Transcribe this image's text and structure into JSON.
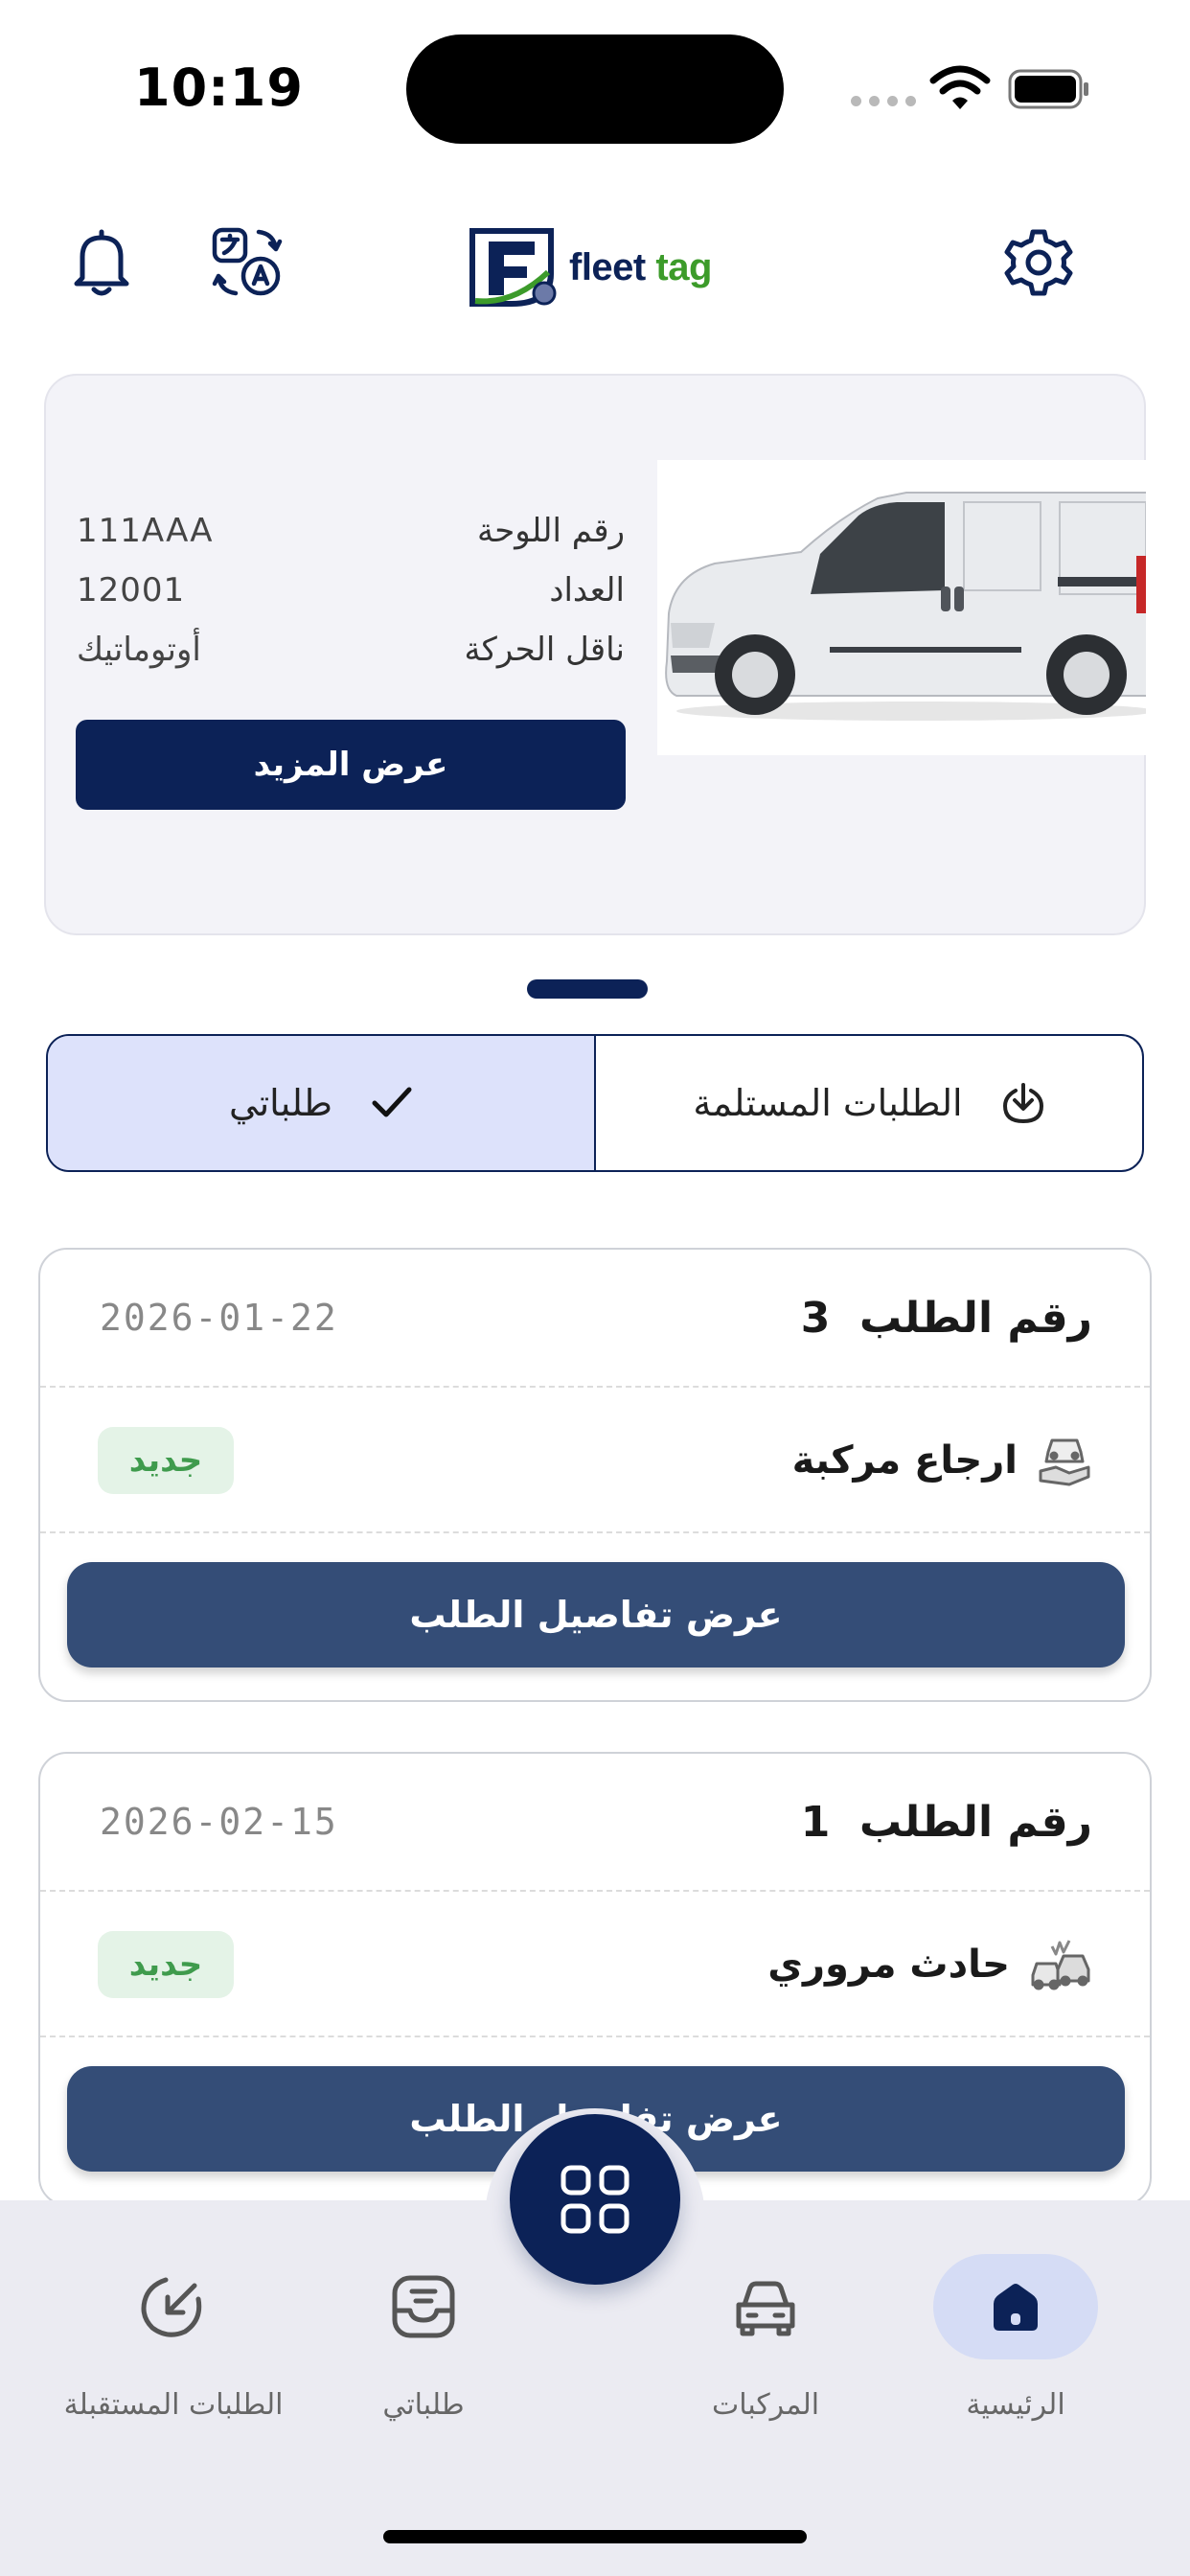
{
  "status_bar": {
    "time": "10:19"
  },
  "header": {
    "logo": {
      "word1": "fleet",
      "word2": "tag"
    },
    "icons": [
      "bell-icon",
      "translate-icon",
      "settings-gear-icon"
    ]
  },
  "vehicle": {
    "specs": [
      {
        "label": "رقم اللوحة",
        "value": "111AAA"
      },
      {
        "label": "العداد",
        "value": "12001"
      },
      {
        "label": "ناقل الحركة",
        "value": "أوتوماتيك"
      }
    ],
    "more_button": "عرض المزيد"
  },
  "tabs": {
    "received": "الطلبات المستلمة",
    "mine": "طلباتي",
    "active": "mine"
  },
  "requests": [
    {
      "title": "رقم الطلب",
      "number": "3",
      "date": "2026-01-22",
      "type": "ارجاع مركبة",
      "type_icon": "car-return-icon",
      "status": "جديد",
      "button": "عرض تفاصيل الطلب"
    },
    {
      "title": "رقم الطلب",
      "number": "1",
      "date": "2026-02-15",
      "type": "حادث مروري",
      "type_icon": "car-accident-icon",
      "status": "جديد",
      "button": "عرض تفاصيل الطلب"
    }
  ],
  "nav": {
    "items": [
      {
        "label": "الرئيسية",
        "icon": "home-icon",
        "active": true
      },
      {
        "label": "المركبات",
        "icon": "car-icon",
        "active": false
      },
      {
        "label": "طلباتي",
        "icon": "inbox-icon",
        "active": false
      },
      {
        "label": "الطلبات المستقبلة",
        "icon": "incoming-arrow-icon",
        "active": false
      }
    ],
    "center_icon": "grid-icon"
  },
  "colors": {
    "primary": "#0c2257",
    "button": "#344d77",
    "active_tab": "#dde2fb",
    "badge_bg": "#e4f3e7",
    "badge_text": "#3f9b4d",
    "logo_green": "#3c9b2a"
  }
}
